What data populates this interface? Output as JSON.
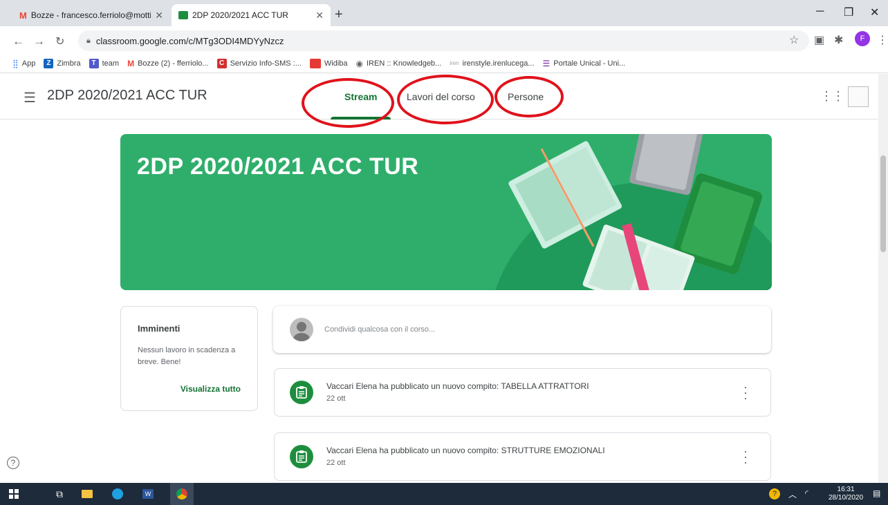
{
  "browser": {
    "tabs": [
      {
        "title": "Bozze - francesco.ferriolo@motti",
        "favicon": "gmail-icon"
      },
      {
        "title": "2DP 2020/2021 ACC TUR",
        "favicon": "classroom-icon"
      }
    ],
    "url": "classroom.google.com/c/MTg3ODI4MDYyNzcz",
    "profile_initial": "F",
    "bookmarks": [
      {
        "label": "App",
        "icon": "apps-grid-icon",
        "color": "#4285f4"
      },
      {
        "label": "Zimbra",
        "icon": "zimbra-icon",
        "color": "#1565c0"
      },
      {
        "label": "team",
        "icon": "teams-icon",
        "color": "#5059c9"
      },
      {
        "label": "Bozze (2) - fferriolo...",
        "icon": "gmail-icon",
        "color": "#ea4335"
      },
      {
        "label": "Servizio Info-SMS :...",
        "icon": "servizio-icon",
        "color": "#d32f2f"
      },
      {
        "label": "Widiba",
        "icon": "widiba-icon",
        "color": "#e53935"
      },
      {
        "label": "IREN :: Knowledgeb...",
        "icon": "globe-icon",
        "color": "#5f6368"
      },
      {
        "label": "irenstyle.irenlucega...",
        "icon": "iren-icon",
        "color": "#9e9e9e"
      },
      {
        "label": "Portale Unical - Uni...",
        "icon": "unical-icon",
        "color": "#6a1b9a"
      }
    ]
  },
  "header": {
    "course_title": "2DP 2020/2021 ACC TUR",
    "tabs": [
      {
        "label": "Stream",
        "active": true
      },
      {
        "label": "Lavori del corso",
        "active": false
      },
      {
        "label": "Persone",
        "active": false
      }
    ]
  },
  "banner": {
    "title": "2DP 2020/2021 ACC TUR",
    "color": "#2fae6b"
  },
  "upcoming": {
    "heading": "Imminenti",
    "text": "Nessun lavoro in scadenza a breve. Bene!",
    "link": "Visualizza tutto"
  },
  "share": {
    "placeholder": "Condividi qualcosa con il corso..."
  },
  "posts": [
    {
      "title": "Vaccari Elena ha pubblicato un nuovo compito: TABELLA ATTRATTORI",
      "date": "22 ott"
    },
    {
      "title": "Vaccari Elena ha pubblicato un nuovo compito: STRUTTURE EMOZIONALI",
      "date": "22 ott"
    }
  ],
  "taskbar": {
    "time": "16:31",
    "date": "28/10/2020"
  }
}
